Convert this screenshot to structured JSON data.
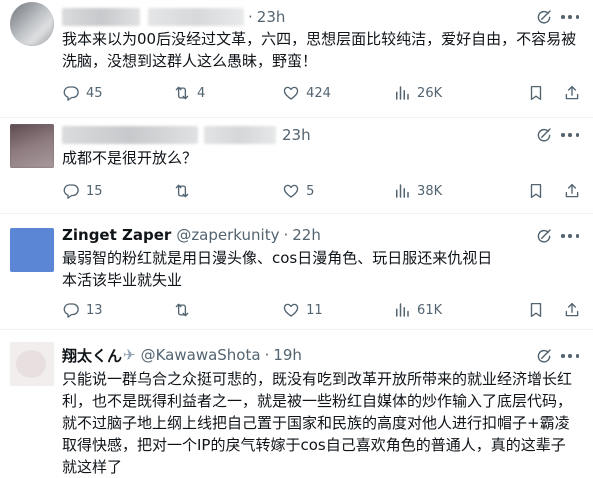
{
  "tweets": [
    {
      "time": "23h",
      "text": "我本来以为00后没经过文革，六四，思想层面比较纯洁，爱好自由，不容易被洗脑，没想到这群人这么愚昧，野蛮！",
      "replies": "45",
      "reposts": "4",
      "likes": "424",
      "views": "26K"
    },
    {
      "time": "23h",
      "text": "成都不是很开放么？",
      "replies": "15",
      "reposts": "",
      "likes": "5",
      "views": "38K"
    },
    {
      "name": "Zinget Zaper",
      "handle": "@zaperkunity",
      "time": "22h",
      "text": "最弱智的粉红就是用日漫头像、cos日漫角色、玩日服还来仇视日本活该毕业就失业",
      "replies": "13",
      "reposts": "",
      "likes": "11",
      "views": "61K"
    },
    {
      "name": "翔太くん",
      "handle": "@KawawaShota",
      "time": "19h",
      "text": "只能说一群乌合之众挺可悲的，既没有吃到改革开放所带来的就业经济增长红利，也不是既得利益者之一，就是被一些粉红自媒体的炒作输入了底层代码，就不过脑子地上纲上线把自己置于国家和民族的高度对他人进行扣帽子+霸凌取得快感，把对一个IP的戾气转嫁于cos自己喜欢角色的普通人，真的这辈子就这样了"
    }
  ],
  "icons": {
    "reply": "speech-bubble-icon",
    "repost": "repost-arrows-icon",
    "like": "heart-icon",
    "views": "bar-chart-icon",
    "bookmark": "bookmark-icon",
    "share": "share-icon",
    "grok": "grok-slash-circle-icon",
    "more": "more-dots-icon",
    "airplane": "airplane-emoji"
  },
  "colors": {
    "text": "#0f1419",
    "muted": "#536471",
    "divider": "#eff3f4",
    "background": "#ffffff"
  }
}
